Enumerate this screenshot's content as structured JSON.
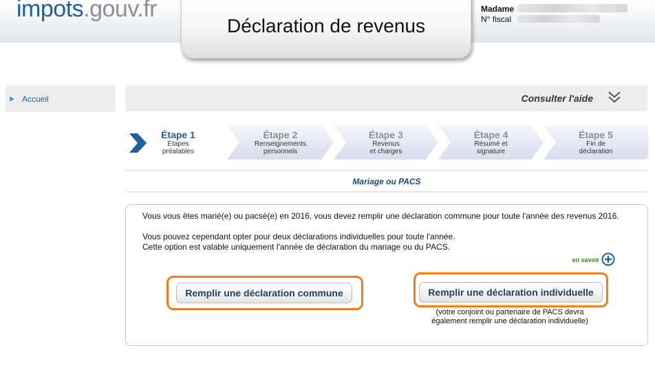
{
  "header": {
    "logo_part1": "impots",
    "logo_part2": ".gouv.fr",
    "title": "Déclaration de revenus",
    "user_title": "Madame",
    "fiscal_label": "N° fiscal"
  },
  "sidebar": {
    "items": [
      {
        "label": "Accueil"
      }
    ]
  },
  "help": {
    "label": "Consulter l'aide",
    "icon": "double-chevron-down-icon"
  },
  "steps": [
    {
      "title": "Étape 1",
      "line1": "Étapes",
      "line2": "préalables",
      "active": true
    },
    {
      "title": "Étape 2",
      "line1": "Renseignements",
      "line2": "personnels",
      "active": false
    },
    {
      "title": "Étape 3",
      "line1": "Revenus",
      "line2": "et charges",
      "active": false
    },
    {
      "title": "Étape 4",
      "line1": "Résumé et",
      "line2": "signature",
      "active": false
    },
    {
      "title": "Étape 5",
      "line1": "Fin de",
      "line2": "déclaration",
      "active": false
    }
  ],
  "section": {
    "title": "Mariage ou PACS"
  },
  "content": {
    "para1": "Vous vous êtes marié(e) ou pacsé(e) en 2016, vous devez remplir une déclaration commune pour toute l'année des revenus 2016.",
    "para2": "Vous pouvez cependant opter pour deux déclarations individuelles pour toute l'année.",
    "para3": "Cette option est valable uniquement l'année de déclaration du mariage ou du PACS.",
    "more_label": "en savoir",
    "more_icon": "plus-circle-icon",
    "button_common": "Remplir une déclaration commune",
    "button_individual": "Remplir une déclaration individuelle",
    "note_line1": "(votre conjoint ou partenaire de PACS devra",
    "note_line2": "également remplir une déclaration individuelle)"
  },
  "colors": {
    "brand_blue": "#1f5f9e",
    "highlight_orange": "#f07d1a",
    "step_inactive": "#e1e6f1",
    "link_green": "#3a8a1c"
  }
}
